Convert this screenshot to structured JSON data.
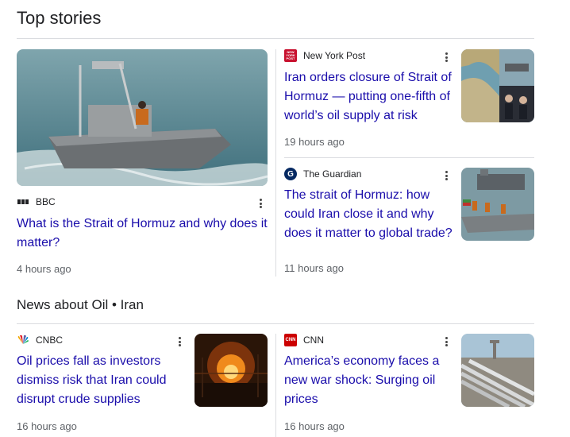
{
  "top_stories": {
    "title": "Top stories",
    "stories": [
      {
        "source": "BBC",
        "headline": "What is the Strait of Hormuz and why does it matter?",
        "time": "4 hours ago"
      },
      {
        "source": "New York Post",
        "headline": "Iran orders closure of Strait of Hormuz — putting one-fifth of world’s oil supply at risk",
        "time": "19 hours ago"
      },
      {
        "source": "The Guardian",
        "headline": "The strait of Hormuz: how could Iran close it and why does it matter to global trade?",
        "time": "11 hours ago"
      }
    ]
  },
  "news_about": {
    "title": "News about Oil • Iran",
    "stories": [
      {
        "source": "CNBC",
        "headline": "Oil prices fall as investors dismiss risk that Iran could disrupt crude supplies",
        "time": "16 hours ago"
      },
      {
        "source": "CNN",
        "headline": "America’s economy faces a new war shock: Surging oil prices",
        "time": "16 hours ago"
      }
    ]
  },
  "logos": {
    "nyp": "NEW YORK POST",
    "guardian": "G",
    "cnn": "CNN"
  },
  "colors": {
    "link": "#1a0dab",
    "muted": "#5f6368",
    "divider": "#dadce0",
    "cnn_red": "#cc0000",
    "nyp_red": "#c8102e"
  }
}
